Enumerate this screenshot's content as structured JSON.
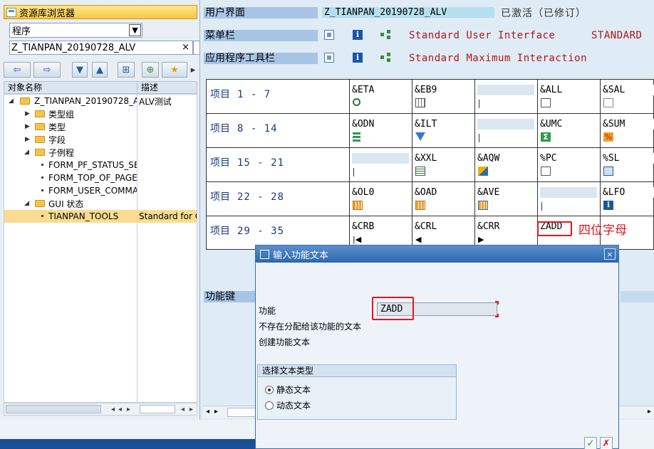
{
  "left_panel": {
    "title": "资源库浏览器",
    "object_type": "程序",
    "object_name": "Z_TIANPAN_20190728_ALV",
    "clear_symbol": "×",
    "toolbar": {
      "back": "⇦",
      "forward": "⇨",
      "down": "▼",
      "up": "▲",
      "binoculars": "⊞",
      "tree_add": "⊕",
      "favorite": "★",
      "more": "▸"
    },
    "tree_header": {
      "col_name": "对象名称",
      "col_desc": "描述"
    },
    "tree": [
      {
        "label": "Z_TIANPAN_20190728_A",
        "desc": "ALV测试",
        "type": "folder",
        "open": true
      },
      {
        "label": "类型组",
        "desc": "",
        "type": "folder",
        "open": false
      },
      {
        "label": "类型",
        "desc": "",
        "type": "folder",
        "open": false
      },
      {
        "label": "字段",
        "desc": "",
        "type": "folder",
        "open": false
      },
      {
        "label": "子例程",
        "desc": "",
        "type": "folder",
        "open": true
      },
      {
        "label": "FORM_PF_STATUS_SE",
        "desc": "",
        "type": "leaf"
      },
      {
        "label": "FORM_TOP_OF_PAGE",
        "desc": "",
        "type": "leaf"
      },
      {
        "label": "FORM_USER_COMMAN",
        "desc": "",
        "type": "leaf"
      },
      {
        "label": "GUI 状态",
        "desc": "",
        "type": "folder",
        "open": true
      },
      {
        "label": "TIANPAN_TOOLS",
        "desc": "Standard for Ge",
        "type": "leaf",
        "selected": true
      }
    ]
  },
  "status": {
    "user_interface_label": "用户界面",
    "program": "Z_TIANPAN_20190728_ALV",
    "state": "已激活（已修订）",
    "menu_bar_label": "菜单栏",
    "menu_bar_text": "Standard User Interface",
    "menu_bar_status": "STANDARD",
    "app_toolbar_label": "应用程序工具栏",
    "app_toolbar_text": "Standard Maximum Interaction",
    "function_keys_label": "功能键"
  },
  "items_table": {
    "rows": [
      {
        "label": "项目",
        "range": "1 -  7",
        "codes": [
          "&ETA",
          "&EB9",
          "",
          "&ALL",
          "&SAL"
        ],
        "icons": [
          "magnifier-icon",
          "table-icon",
          "",
          "select-all-icon",
          "deselect-all-icon"
        ]
      },
      {
        "label": "项目",
        "range": "8 - 14",
        "codes": [
          "&ODN",
          "&ILT",
          "",
          "&UMC",
          "&SUM"
        ],
        "icons": [
          "sort-icon",
          "filter-icon",
          "",
          "sigma-icon",
          "subtotal-icon"
        ]
      },
      {
        "label": "项目",
        "range": "15 - 21",
        "codes": [
          "",
          "&XXL",
          "&AQW",
          "%PC",
          "%SL"
        ],
        "icons": [
          "",
          "excel-icon",
          "word-icon",
          "export-icon",
          "mail-icon"
        ]
      },
      {
        "label": "项目",
        "range": "22 - 28",
        "codes": [
          "&OL0",
          "&OAD",
          "&AVE",
          "",
          "&LFO"
        ],
        "icons": [
          "layout-icon",
          "layout-select-icon",
          "layout-save-icon",
          "",
          "info-icon"
        ]
      },
      {
        "label": "项目",
        "range": "29 - 35",
        "codes": [
          "&CRB",
          "&CRL",
          "&CRR",
          "ZADD",
          ""
        ],
        "icons": [
          "first-page-icon",
          "prev-icon",
          "next-icon",
          "",
          ""
        ]
      }
    ]
  },
  "annotation": {
    "label": "四位字母"
  },
  "dialog": {
    "title": "输入功能文本",
    "close": "×",
    "function_label": "功能",
    "function_value": "ZADD",
    "no_text_msg": "不存在分配给该功能的文本",
    "create_msg": "创建功能文本",
    "group_title": "选择文本类型",
    "option_static": "静态文本",
    "option_dynamic": "动态文本",
    "ok": "✓",
    "cancel": "✗"
  },
  "colors": {
    "accent": "#2c66ad",
    "annotation": "#e6151b",
    "label_bg": "#a8c4e5",
    "status_red": "#b0151c"
  }
}
